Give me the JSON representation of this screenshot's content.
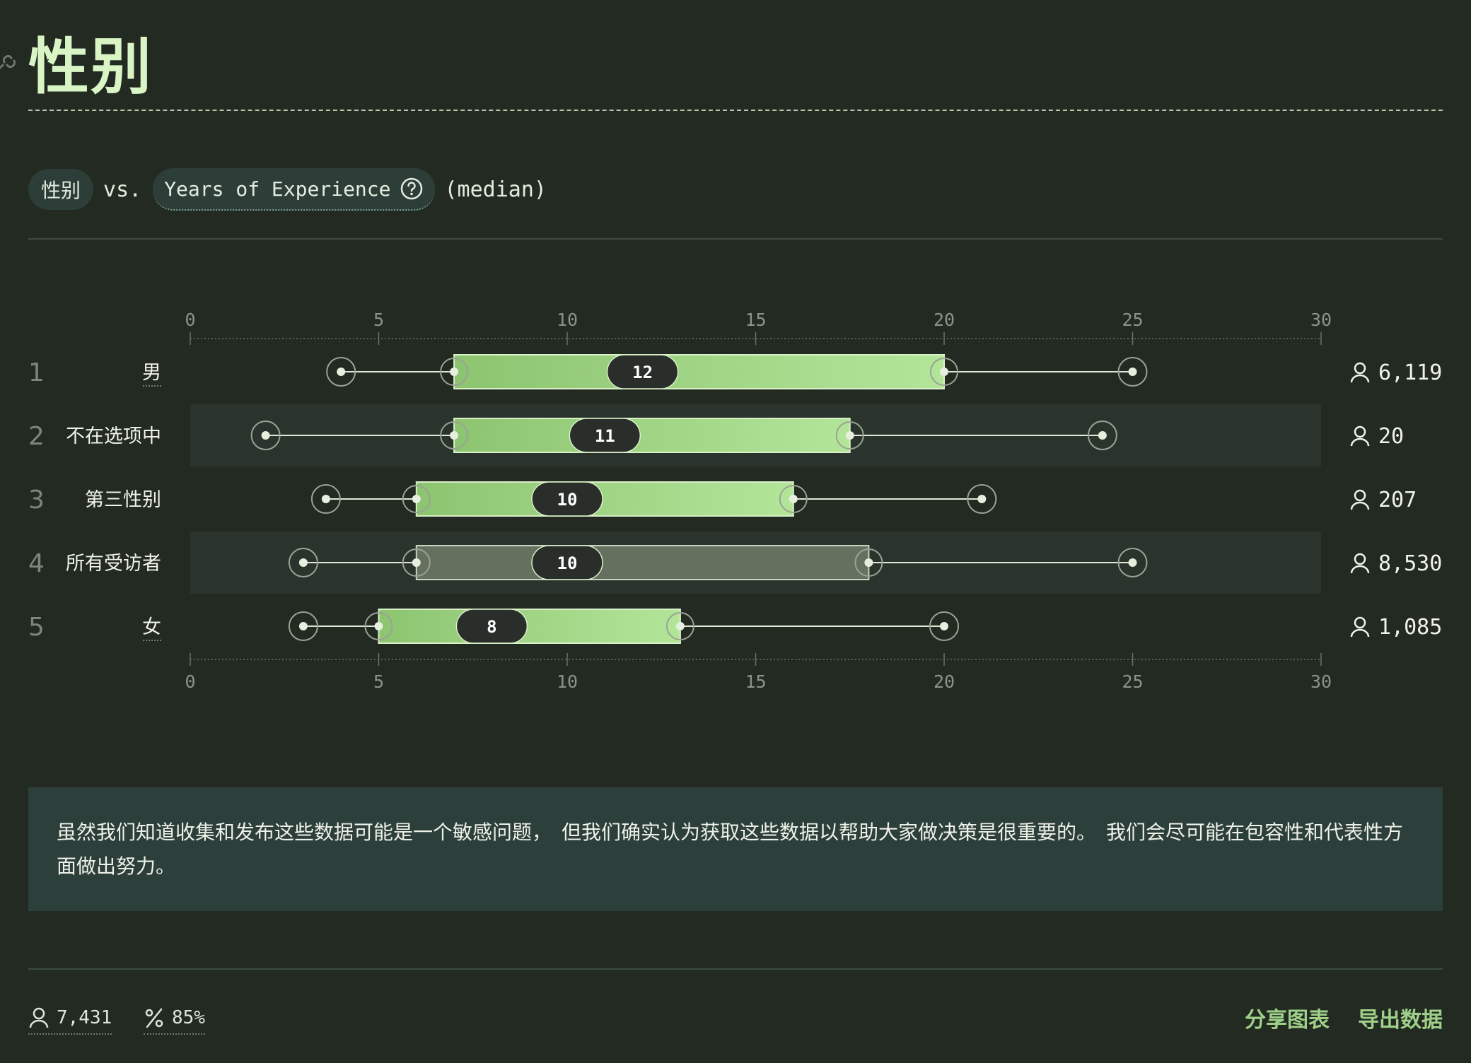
{
  "header": {
    "title": "性别"
  },
  "subheader": {
    "group_chip": "性别",
    "vs": "vs.",
    "variable_chip": "Years of Experience",
    "stat": "(median)"
  },
  "chart_data": {
    "type": "boxplot",
    "x_range": [
      0,
      30
    ],
    "x_ticks": [
      0,
      5,
      10,
      15,
      20,
      25,
      30
    ],
    "rows": [
      {
        "rank": "1",
        "label": "男",
        "whisker_low": 4,
        "q1": 7,
        "median": 12,
        "q3": 20,
        "whisker_high": 25,
        "count": "6,119",
        "highlight": false,
        "underline": true
      },
      {
        "rank": "2",
        "label": "不在选项中",
        "whisker_low": 2,
        "q1": 7,
        "median": 11,
        "q3": 17.5,
        "whisker_high": 24.2,
        "count": "20",
        "highlight": false,
        "underline": false
      },
      {
        "rank": "3",
        "label": "第三性别",
        "whisker_low": 3.6,
        "q1": 6,
        "median": 10,
        "q3": 16,
        "whisker_high": 21,
        "count": "207",
        "highlight": false,
        "underline": false
      },
      {
        "rank": "4",
        "label": "所有受访者",
        "whisker_low": 3,
        "q1": 6,
        "median": 10,
        "q3": 18,
        "whisker_high": 25,
        "count": "8,530",
        "highlight": true,
        "underline": false
      },
      {
        "rank": "5",
        "label": "女",
        "whisker_low": 3,
        "q1": 5,
        "median": 8,
        "q3": 13,
        "whisker_high": 20,
        "count": "1,085",
        "highlight": false,
        "underline": true
      }
    ],
    "colors": {
      "box_start": "#8cc470",
      "box_end": "#b3e599",
      "box_all": "#65705f",
      "median_pill": "#2a2e2b"
    }
  },
  "note": {
    "text": "虽然我们知道收集和发布这些数据可能是一个敏感问题，　但我们确实认为获取这些数据以帮助大家做决策是很重要的。　我们会尽可能在包容性和代表性方面做出努力。"
  },
  "footer": {
    "respondents": "7,431",
    "percent": "85%",
    "share_label": "分享图表",
    "export_label": "导出数据"
  }
}
